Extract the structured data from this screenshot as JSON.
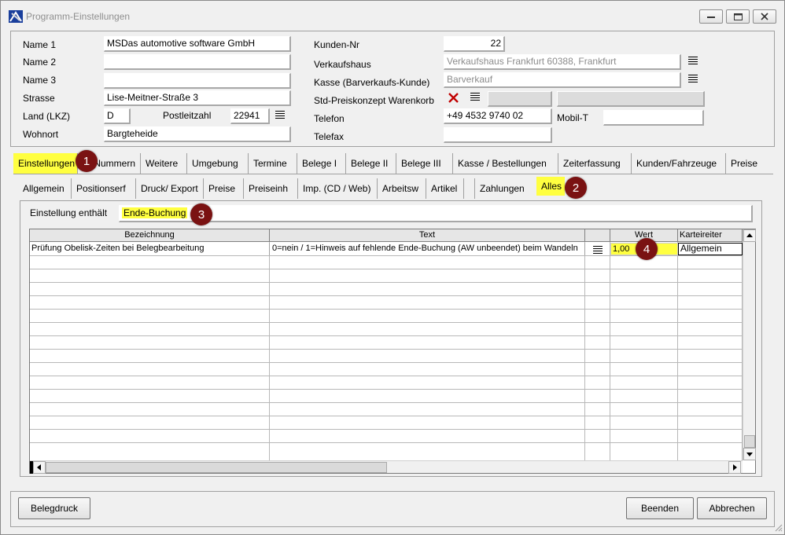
{
  "window": {
    "title": "Programm-Einstellungen"
  },
  "customer": {
    "name1_label": "Name 1",
    "name1_value": "MSDas automotive software GmbH",
    "name2_label": "Name 2",
    "name2_value": "",
    "name3_label": "Name 3",
    "name3_value": "",
    "street_label": "Strasse",
    "street_value": "Lise-Meitner-Straße 3",
    "country_label": "Land (LKZ)",
    "country_value": "D",
    "zip_label": "Postleitzahl",
    "zip_value": "22941",
    "city_label": "Wohnort",
    "city_value": "Bargteheide",
    "custno_label": "Kunden-Nr",
    "custno_value": "22",
    "store_label": "Verkaufshaus",
    "store_value": "Verkaufshaus Frankfurt 60388, Frankfurt",
    "cash_label": "Kasse (Barverkaufs-Kunde)",
    "cash_value": "Barverkauf",
    "price_label": "Std-Preiskonzept Warenkorb",
    "phone_label": "Telefon",
    "phone_value": "+49 4532 9740 02",
    "mobile_label": "Mobil-T",
    "mobile_value": "",
    "fax_label": "Telefax",
    "fax_value": ""
  },
  "main_tabs": [
    "Einstellungen",
    "Nummern",
    "Weitere",
    "Umgebung",
    "Termine",
    "Belege I",
    "Belege II",
    "Belege III",
    "Kasse / Bestellungen",
    "Zeiterfassung",
    "Kunden/Fahrzeuge",
    "Preise"
  ],
  "sub_tabs": [
    "Allgemein",
    "Positionserf",
    "Druck/ Export",
    "Preise",
    "Preiseinh",
    "Imp. (CD / Web)",
    "Arbeitsw",
    "Artikel",
    "",
    "Zahlungen",
    "Alles"
  ],
  "filter": {
    "label": "Einstellung enthält",
    "value": "Ende-Buchung"
  },
  "grid": {
    "columns": [
      "Bezeichnung",
      "Text",
      "",
      "Wert",
      "Karteireiter"
    ],
    "rows": [
      {
        "bezeichnung": "Prüfung Obelisk-Zeiten bei Belegbearbeitung",
        "text": "0=nein / 1=Hinweis auf fehlende Ende-Buchung (AW unbeendet) beim Wandeln",
        "wert": "1,00",
        "karteireiter": "Allgemein"
      }
    ]
  },
  "badges": [
    "1",
    "2",
    "3",
    "4"
  ],
  "buttons": {
    "belegdruck": "Belegdruck",
    "beenden": "Beenden",
    "abbrechen": "Abbrechen"
  },
  "colors": {
    "highlight": "#ffff40",
    "badge": "#7a1212",
    "delete_x": "#c00000"
  }
}
